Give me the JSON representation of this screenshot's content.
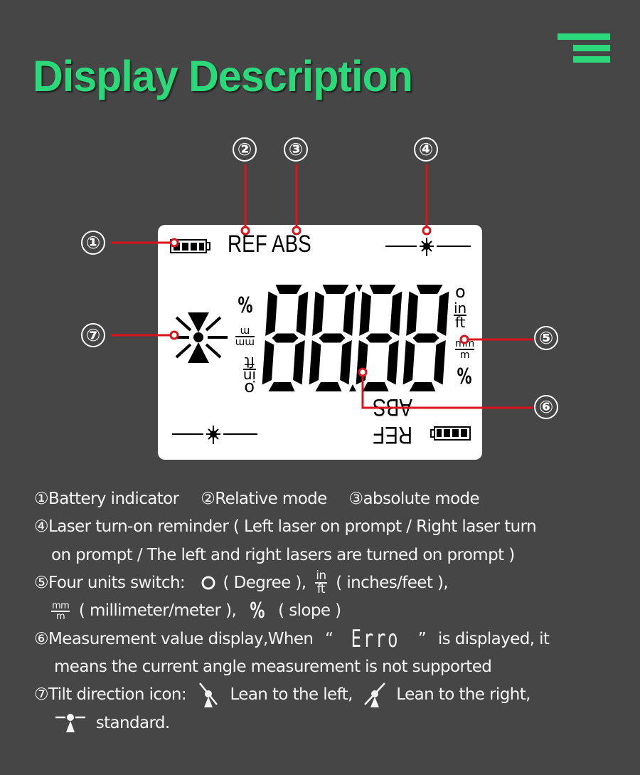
{
  "header": {
    "title": "Display Description",
    "menu_icon": "menu-icon",
    "accent_color": "#2bd97b"
  },
  "callouts": [
    "①",
    "②",
    "③",
    "④",
    "⑤",
    "⑥",
    "⑦"
  ],
  "lcd": {
    "top_mode_label": "REF ABS",
    "bottom_mode_label": "REF ABS",
    "digits": "88.88",
    "left_units": [
      "%",
      "mm/m",
      "in/ft",
      "o"
    ],
    "right_units": [
      "o",
      "in/ft",
      "mm/m",
      "%"
    ],
    "unit_in": "in",
    "unit_ft": "ft",
    "unit_mm": "mm",
    "unit_m": "m",
    "unit_pct": "%",
    "leader_color": "#d9131b"
  },
  "legend": {
    "item1": "①Battery indicator",
    "item2": "②Relative mode",
    "item3": "③absolute mode",
    "item4_line1": "④Laser turn-on reminder ( Left laser on prompt / Right laser turn",
    "item4_line2": "on prompt / The left and right lasers are turned on prompt )",
    "item5_prefix": "⑤Four units switch:",
    "item5_degree": "( Degree ),",
    "item5_in": "in",
    "item5_ft": "ft",
    "item5_inft": "( inches/feet ),",
    "item5_mm": "mm",
    "item5_m": "m",
    "item5_mmm": "( millimeter/meter ),",
    "item5_pct": "%",
    "item5_slope": "( slope )",
    "item6_prefix": "⑥Measurement value display,When",
    "item6_open_quote": "“",
    "item6_erro": "Erro",
    "item6_close_quote": "”",
    "item6_suffix": "is displayed, it",
    "item6_line2": "means the current angle measurement is not supported",
    "item7_prefix": "⑦Tilt direction icon:",
    "item7_left": "Lean to the left,",
    "item7_right": "Lean to the right,",
    "item7_standard": "standard."
  }
}
